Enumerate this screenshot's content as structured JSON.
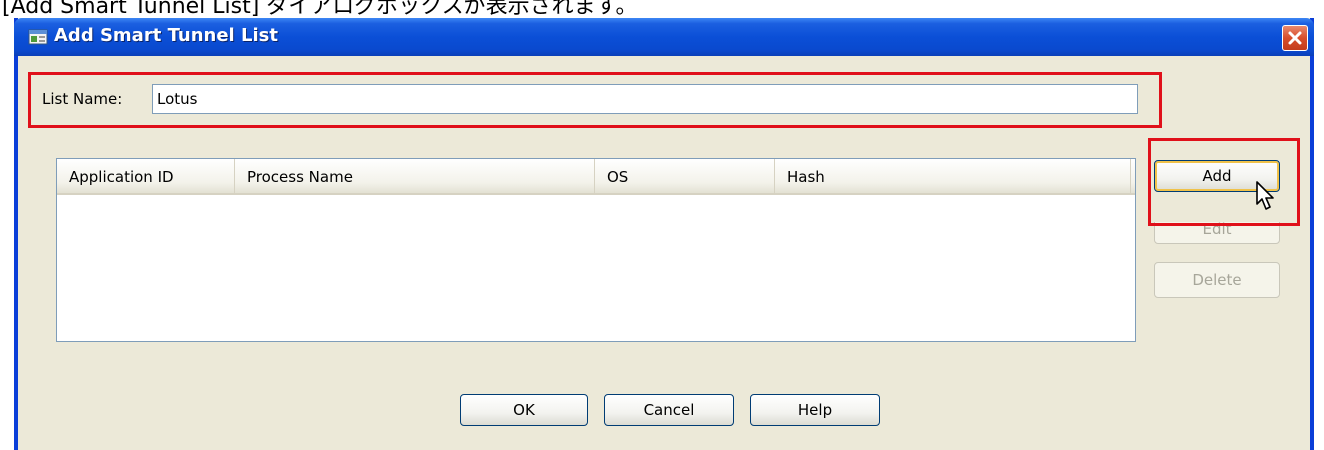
{
  "caption": "[Add Smart Tunnel List] ダイアログボックスが表示されます。",
  "window": {
    "title": "Add Smart Tunnel List",
    "icon": "app-window-icon",
    "close_icon": "close-icon"
  },
  "form": {
    "list_name_label": "List Name:",
    "list_name_value": "Lotus"
  },
  "table": {
    "columns": [
      "Application ID",
      "Process Name",
      "OS",
      "Hash"
    ],
    "rows": []
  },
  "side_buttons": {
    "add": "Add",
    "edit": "Edit",
    "delete": "Delete"
  },
  "footer_buttons": {
    "ok": "OK",
    "cancel": "Cancel",
    "help": "Help"
  },
  "colors": {
    "highlight": "#e0101a",
    "titlebar": "#0b4fd7",
    "dialog_bg": "#ece9d8"
  }
}
